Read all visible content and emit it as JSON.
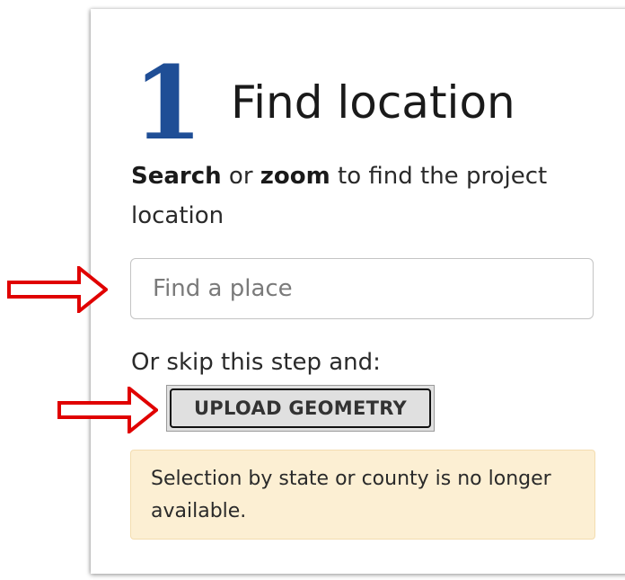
{
  "step": {
    "number": "1",
    "title": "Find location"
  },
  "instructions": {
    "word_search": "Search",
    "text_or": " or ",
    "word_zoom": "zoom",
    "text_rest": " to find the project location"
  },
  "search": {
    "placeholder": "Find a place",
    "value": ""
  },
  "skip": {
    "text": "Or skip this step and:"
  },
  "upload": {
    "label": "UPLOAD GEOMETRY"
  },
  "notice": {
    "text": "Selection by state or county is no longer available."
  },
  "annotations": {
    "arrow_color": "#e00000",
    "arrow_targets": [
      "search-input",
      "upload-geometry-button"
    ]
  },
  "colors": {
    "step_number": "#1f4e96",
    "notice_bg": "#fcefd3"
  }
}
